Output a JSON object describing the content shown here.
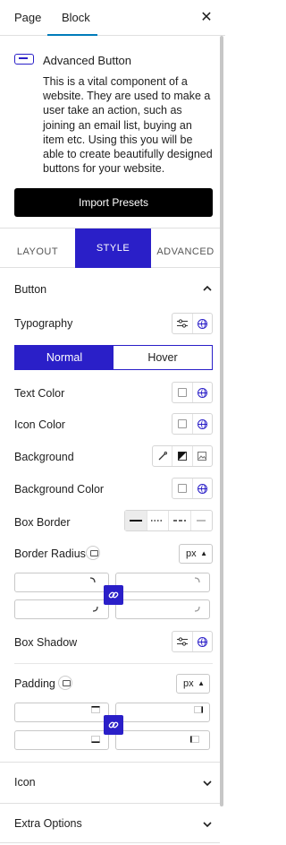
{
  "header": {
    "tabs": [
      "Page",
      "Block"
    ],
    "active_tab": "Block",
    "close_icon": "close-icon"
  },
  "block_info": {
    "title": "Advanced Button",
    "description": "This is a vital component of a website. They are used to make a user take an action, such as joining an email list, buying an item etc. Using this you will be able to create beautifully designed buttons for your website.",
    "import_label": "Import Presets"
  },
  "style_tabs": [
    "LAYOUT",
    "STYLE",
    "ADVANCED"
  ],
  "active_style_tab": "STYLE",
  "button_section": {
    "title": "Button",
    "typography_label": "Typography",
    "state_toggle": [
      "Normal",
      "Hover"
    ],
    "active_state": "Normal",
    "text_color_label": "Text Color",
    "icon_color_label": "Icon Color",
    "background_label": "Background",
    "background_color_label": "Background Color",
    "box_border_label": "Box Border",
    "border_radius_label": "Border Radius",
    "border_radius_unit": "px",
    "box_shadow_label": "Box Shadow",
    "padding_label": "Padding",
    "padding_unit": "px"
  },
  "collapsed_sections": [
    "Icon",
    "Extra Options"
  ],
  "colors": {
    "accent": "#2a1fc8",
    "import_bg": "#000000"
  }
}
